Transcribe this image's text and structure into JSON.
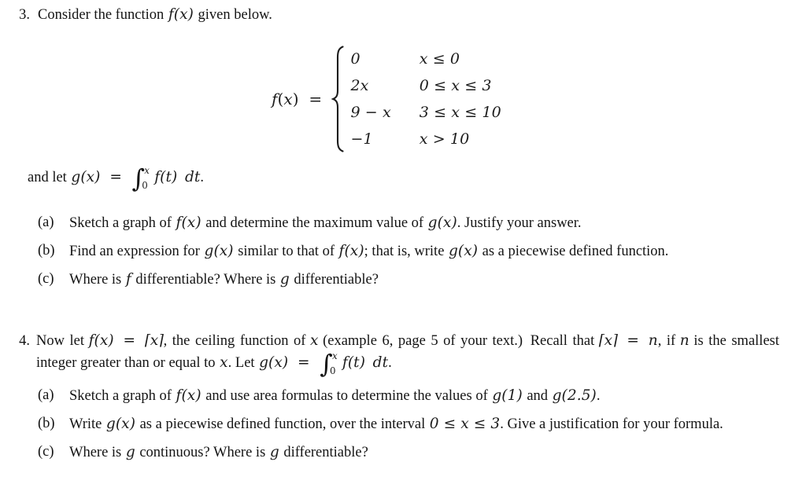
{
  "document": {
    "type": "calculus-homework-problems",
    "background_color": "#ffffff",
    "text_color": "#141414"
  },
  "problem3": {
    "number": "3.",
    "stem_before_fx": "Consider the function",
    "fx": "f(x)",
    "stem_after_fx": "given below.",
    "equation": {
      "lhs_f": "f",
      "lhs_paren_open": "(",
      "lhs_var": "x",
      "lhs_paren_close": ")",
      "equals": "=",
      "cases": [
        {
          "value": "0",
          "condition_lhs": "x",
          "condition_rel": "≤",
          "condition_rhs": "0"
        },
        {
          "value": "2x",
          "condition": "0 ≤ x ≤ 3"
        },
        {
          "value": "9 − x",
          "condition": "3 ≤ x ≤ 10"
        },
        {
          "value": "−1",
          "condition": "x > 10"
        }
      ],
      "cases_values": [
        "0",
        "2x",
        "9 − x",
        "−1"
      ],
      "cases_conditions": [
        "x ≤ 0",
        "0 ≤ x ≤ 3",
        "3 ≤ x ≤ 10",
        "x > 10"
      ]
    },
    "andlet": {
      "prefix": "and let",
      "gx": "g(x)",
      "equals": "=",
      "integral_lower": "0",
      "integral_upper": "x",
      "integrand": "f(t)",
      "differential": "dt",
      "period": "."
    },
    "parts": [
      {
        "label": "(a)",
        "text_1": "Sketch a graph of",
        "math_1": "f(x)",
        "text_2": "and determine the maximum value of",
        "math_2": "g(x)",
        "text_3": ". Justify your answer."
      },
      {
        "label": "(b)",
        "text_1": "Find an expression for",
        "math_1": "g(x)",
        "text_2": "similar to that of",
        "math_2": "f(x)",
        "text_3": "; that is, write",
        "math_3": "g(x)",
        "text_4": "as a piecewise defined function."
      },
      {
        "label": "(c)",
        "text_1": "Where is",
        "math_1": "f",
        "text_2": "differentiable? Where is",
        "math_2": "g",
        "text_3": "differentiable?"
      }
    ]
  },
  "problem4": {
    "number": "4.",
    "line1_a": "Now let",
    "line1_fx": "f(x)",
    "line1_eq": "=",
    "line1_ceil": "⌈x⌉",
    "line1_b": ", the ceiling function of",
    "line1_x": "x",
    "line1_c": "(example 6, page 5 of your text.)",
    "line1_d": "Recall that",
    "line2_ceil": "⌈x⌉",
    "line2_eq": "=",
    "line2_n": "n",
    "line2_a": ", if",
    "line2_n2": "n",
    "line2_b": "is the smallest integer greater than or equal to",
    "line2_x": "x",
    "line2_c": ". Let",
    "line2_gx": "g(x)",
    "line2_eq2": "=",
    "integral_lower": "0",
    "integral_upper": "x",
    "integrand": "f(t)",
    "differential": "dt",
    "line2_period": ".",
    "parts": [
      {
        "label": "(a)",
        "text_1": "Sketch a graph of",
        "math_1": "f(x)",
        "text_2": "and use area formulas to determine the values of",
        "math_2": "g(1)",
        "text_3": "and",
        "math_3": "g(2.5)",
        "text_4": "."
      },
      {
        "label": "(b)",
        "text_1": "Write",
        "math_1": "g(x)",
        "text_2": "as a piecewise defined function, over the interval",
        "math_2": "0 ≤ x ≤ 3",
        "text_3": ". Give a justification for your formula."
      },
      {
        "label": "(c)",
        "text_1": "Where is",
        "math_1": "g",
        "text_2": "continuous? Where is",
        "math_2": "g",
        "text_3": "differentiable?"
      }
    ]
  }
}
